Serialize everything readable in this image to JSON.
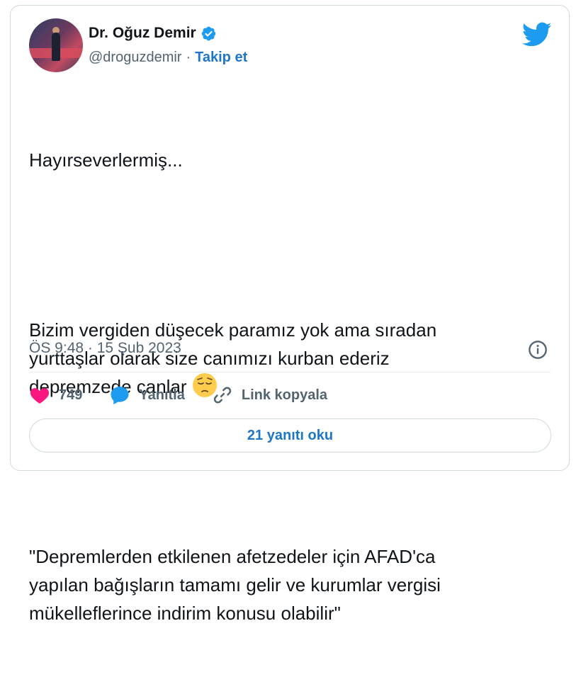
{
  "author": {
    "name": "Dr. Oğuz Demir",
    "handle": "@droguzdemir",
    "separator": "·",
    "follow_label": "Takip et"
  },
  "tweet": {
    "line1": "Hayırseverlermiş...",
    "para2": "Bizim vergiden düşecek paramız yok ama sıradan\nyurttaşlar olarak size canımızı kurban ederiz\ndepremzede canlar",
    "para3": "\"Depremlerden etkilenen afetzedeler için AFAD'ca\nyapılan bağışların tamamı gelir ve kurumlar vergisi\nmükelleflerince indirim konusu olabilir\"",
    "emoji": "pensive-face"
  },
  "meta": {
    "timestamp": "ÖS 9:48 · 15 Şub 2023"
  },
  "actions": {
    "like_count": "749",
    "reply_label": "Yanıtla",
    "copy_link_label": "Link kopyala"
  },
  "read_replies_label": "21 yanıtı oku",
  "colors": {
    "accent": "#1d76c9",
    "verified": "#1d9bf0",
    "like": "#f91880",
    "text": "#0f1419",
    "muted": "#536471",
    "border": "#cfd9de"
  }
}
